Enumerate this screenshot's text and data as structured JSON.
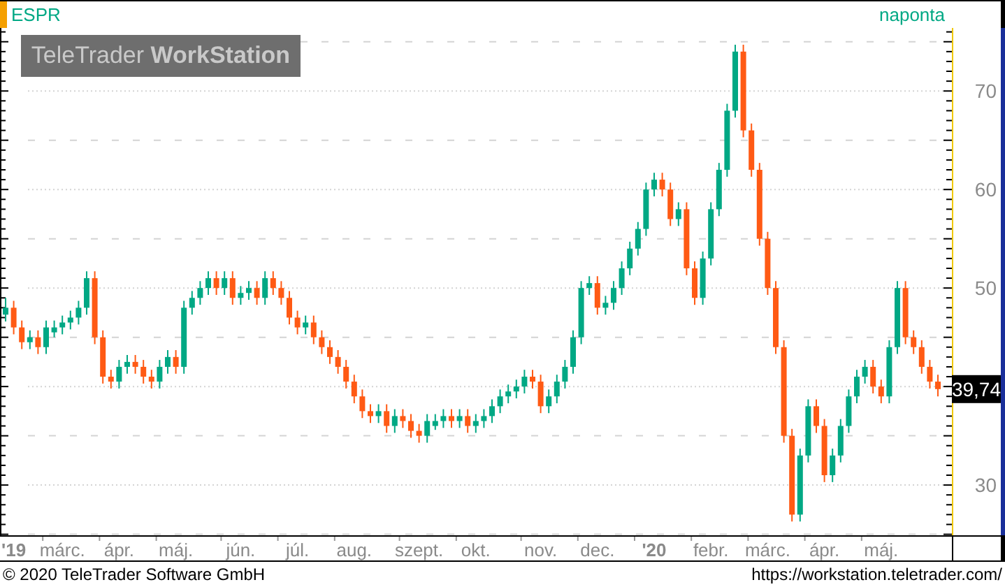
{
  "header": {
    "symbol": "ESPR",
    "interval": "naponta"
  },
  "logo": "TeleTrader **WorkStation**",
  "price_tag": "39,74",
  "chart_data": {
    "type": "candlestick",
    "grid": true,
    "ylim": [
      24.9,
      76.4
    ],
    "yticks": [
      30,
      50,
      60,
      70
    ],
    "categories": [
      null,
      "'19",
      null,
      null,
      null,
      null,
      null,
      "márc.",
      null,
      null,
      null,
      null,
      null,
      null,
      "ápr.",
      null,
      null,
      null,
      null,
      null,
      null,
      "máj.",
      null,
      null,
      null,
      null,
      null,
      null,
      null,
      "jún.",
      null,
      null,
      null,
      null,
      null,
      null,
      "júl.",
      null,
      null,
      null,
      null,
      null,
      null,
      "aug.",
      null,
      null,
      null,
      null,
      null,
      null,
      null,
      "szept.",
      null,
      null,
      null,
      null,
      null,
      null,
      "okt.",
      null,
      null,
      null,
      null,
      null,
      null,
      null,
      "nov.",
      null,
      null,
      null,
      null,
      null,
      null,
      "dec.",
      null,
      null,
      null,
      null,
      null,
      null,
      "'20",
      null,
      null,
      null,
      null,
      null,
      null,
      "febr.",
      null,
      null,
      null,
      null,
      null,
      null,
      "márc.",
      null,
      null,
      null,
      null,
      null,
      null,
      "ápr.",
      null,
      null,
      null,
      null,
      null,
      null,
      "máj.",
      null,
      null,
      null,
      null,
      null,
      null,
      null
    ],
    "ohlc": [
      [
        47.3,
        49,
        46.6,
        48
      ],
      [
        48,
        48.7,
        45.3,
        46
      ],
      [
        46,
        46.7,
        43.8,
        44.5
      ],
      [
        44.5,
        45.7,
        43.8,
        45
      ],
      [
        45,
        45.7,
        43.3,
        44
      ],
      [
        44,
        46.7,
        43.3,
        46
      ],
      [
        45.5,
        46.7,
        45,
        46
      ],
      [
        46,
        47.2,
        45.3,
        46.5
      ],
      [
        46.5,
        47.7,
        45.8,
        47
      ],
      [
        47,
        48.7,
        46.3,
        48
      ],
      [
        48,
        51.7,
        47.3,
        51
      ],
      [
        51,
        51.7,
        44.3,
        45
      ],
      [
        45,
        45.7,
        40.3,
        41
      ],
      [
        41,
        41.7,
        39.8,
        40.5
      ],
      [
        40.5,
        42.7,
        39.8,
        42
      ],
      [
        42,
        43.2,
        41.3,
        42.5
      ],
      [
        42.5,
        43.2,
        41.3,
        42
      ],
      [
        42,
        42.7,
        40.3,
        41
      ],
      [
        41,
        41.7,
        39.8,
        40.5
      ],
      [
        40.5,
        42.7,
        39.8,
        42
      ],
      [
        42,
        43.7,
        41.3,
        43
      ],
      [
        43,
        43.7,
        41.3,
        42
      ],
      [
        42,
        48.7,
        41.3,
        48
      ],
      [
        48,
        49.7,
        47.3,
        49
      ],
      [
        49,
        50.7,
        48.3,
        50
      ],
      [
        50,
        51.7,
        49.3,
        51
      ],
      [
        51,
        51.7,
        49.3,
        50
      ],
      [
        50,
        51.7,
        49.3,
        51
      ],
      [
        51,
        51.7,
        48.3,
        49
      ],
      [
        49,
        50.2,
        48.3,
        49.5
      ],
      [
        49.5,
        50.7,
        48.8,
        50
      ],
      [
        50,
        50.7,
        48.3,
        49
      ],
      [
        49,
        51.7,
        48.3,
        51
      ],
      [
        51,
        51.7,
        49.3,
        50
      ],
      [
        50,
        50.7,
        48.3,
        49
      ],
      [
        49,
        49.7,
        46.3,
        47
      ],
      [
        47,
        47.7,
        45.3,
        46
      ],
      [
        46,
        47.2,
        45.3,
        46.5
      ],
      [
        46.5,
        47.2,
        44.3,
        45
      ],
      [
        45,
        45.7,
        43.3,
        44
      ],
      [
        44,
        44.7,
        42.3,
        43
      ],
      [
        43,
        43.7,
        41.3,
        42
      ],
      [
        42,
        42.7,
        39.8,
        40.5
      ],
      [
        40.5,
        41.2,
        38.3,
        39
      ],
      [
        39,
        39.7,
        36.8,
        37.5
      ],
      [
        37.5,
        38.2,
        36.3,
        37
      ],
      [
        37,
        38.2,
        36.3,
        37.5
      ],
      [
        37.5,
        38.2,
        35.3,
        36
      ],
      [
        36,
        37.7,
        35.3,
        37
      ],
      [
        37,
        37.7,
        35.8,
        36.5
      ],
      [
        36.5,
        37.2,
        34.8,
        35.5
      ],
      [
        35.5,
        36.2,
        34.3,
        35
      ],
      [
        35,
        37.2,
        34.3,
        36.5
      ],
      [
        36,
        37.2,
        35.6,
        36.5
      ],
      [
        36.5,
        37.7,
        35.8,
        37
      ],
      [
        37,
        37.7,
        35.8,
        36.5
      ],
      [
        36.5,
        37.7,
        35.8,
        37
      ],
      [
        37,
        37.7,
        35.3,
        36
      ],
      [
        36,
        37.2,
        35.3,
        36.5
      ],
      [
        36.5,
        37.7,
        35.8,
        37
      ],
      [
        37,
        38.7,
        36.3,
        38
      ],
      [
        38,
        39.7,
        37.3,
        39
      ],
      [
        39,
        40.2,
        38.3,
        39.5
      ],
      [
        39.5,
        40.7,
        38.8,
        40
      ],
      [
        40,
        41.7,
        39.3,
        41
      ],
      [
        41,
        41.7,
        39.8,
        40.5
      ],
      [
        40.5,
        41.2,
        37.3,
        38
      ],
      [
        38,
        39.7,
        37.3,
        39
      ],
      [
        39,
        41.2,
        38.3,
        40.5
      ],
      [
        40.5,
        42.7,
        39.8,
        42
      ],
      [
        42,
        45.7,
        41.3,
        45
      ],
      [
        45,
        50.7,
        44.3,
        50
      ],
      [
        50,
        51.2,
        49.3,
        50.5
      ],
      [
        50.5,
        51.2,
        47.3,
        48
      ],
      [
        48,
        49.2,
        47.3,
        48.5
      ],
      [
        48.5,
        50.7,
        47.8,
        50
      ],
      [
        50,
        52.7,
        49.3,
        52
      ],
      [
        52,
        54.7,
        51.3,
        54
      ],
      [
        54,
        56.7,
        53.3,
        56
      ],
      [
        56,
        60.7,
        55.3,
        60
      ],
      [
        60,
        61.7,
        59.3,
        61
      ],
      [
        61,
        61.7,
        59.3,
        60
      ],
      [
        60,
        60.7,
        56.3,
        57
      ],
      [
        57,
        58.7,
        56.3,
        58
      ],
      [
        58,
        58.7,
        51.3,
        52
      ],
      [
        52,
        52.7,
        48.3,
        49
      ],
      [
        49,
        53.7,
        48.3,
        53
      ],
      [
        53,
        58.7,
        52.3,
        58
      ],
      [
        58,
        62.7,
        57.3,
        62
      ],
      [
        62,
        68.7,
        61.3,
        68
      ],
      [
        68,
        74.7,
        67.3,
        74
      ],
      [
        74,
        74.7,
        65.3,
        66
      ],
      [
        66,
        66.7,
        61.3,
        62
      ],
      [
        62,
        62.7,
        54.3,
        55
      ],
      [
        55,
        55.7,
        49.3,
        50
      ],
      [
        50,
        50.7,
        43.3,
        44
      ],
      [
        44,
        44.7,
        34.3,
        35
      ],
      [
        35,
        35.7,
        26.3,
        27
      ],
      [
        27,
        33.7,
        26.3,
        33
      ],
      [
        33,
        38.7,
        32.3,
        38
      ],
      [
        38,
        38.7,
        35.3,
        36
      ],
      [
        36,
        36.7,
        30.3,
        31
      ],
      [
        31,
        33.7,
        30.3,
        33
      ],
      [
        33,
        36.7,
        32.3,
        36
      ],
      [
        36,
        39.7,
        35.3,
        39
      ],
      [
        39,
        41.7,
        38.3,
        41
      ],
      [
        41,
        42.7,
        40.3,
        42
      ],
      [
        42,
        42.7,
        39.3,
        40
      ],
      [
        40,
        40.7,
        38.3,
        39
      ],
      [
        39,
        44.7,
        38.3,
        44
      ],
      [
        44,
        50.7,
        43.3,
        50
      ],
      [
        50,
        50.7,
        44.3,
        45
      ],
      [
        45,
        45.7,
        43.3,
        44
      ],
      [
        44,
        44.7,
        41.3,
        42
      ],
      [
        42,
        42.7,
        39.8,
        40.5
      ],
      [
        40.5,
        41.2,
        39,
        39.74
      ]
    ]
  },
  "footer": {
    "copyright": "© 2020 TeleTrader Software GmbH",
    "url": "https://workstation.teletrader.com/"
  }
}
